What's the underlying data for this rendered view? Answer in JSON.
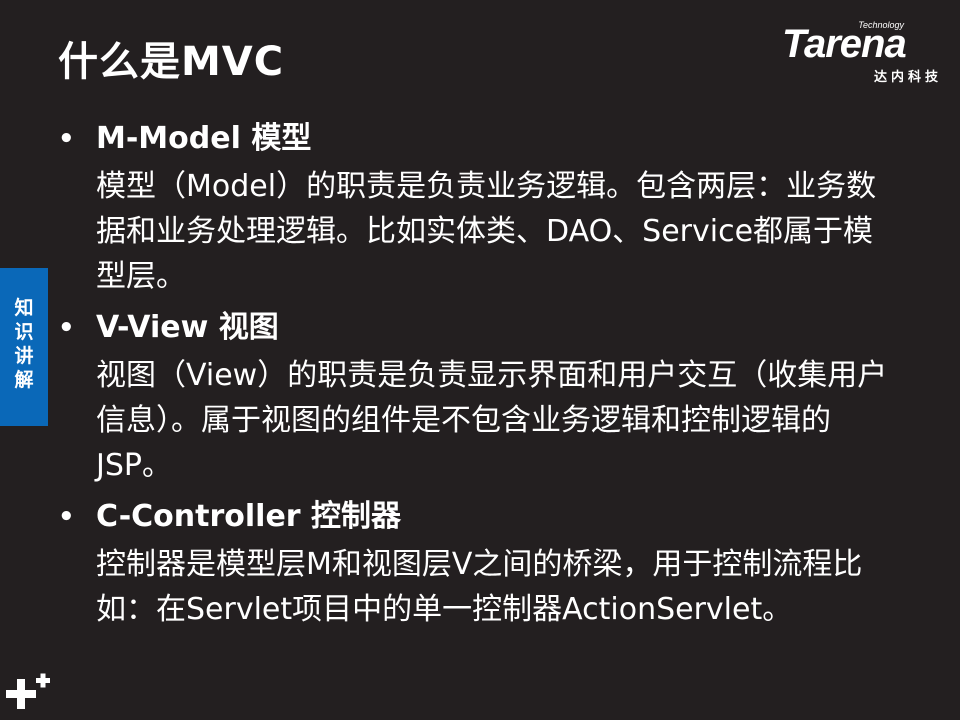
{
  "title": "什么是MVC",
  "logo": {
    "tech": "Technology",
    "main": "Tarena",
    "sub": "达内科技"
  },
  "side_tab": "知识讲解",
  "sections": [
    {
      "heading": "M-Model 模型",
      "body": "模型（Model）的职责是负责业务逻辑。包含两层：业务数据和业务处理逻辑。比如实体类、DAO、Service都属于模型层。"
    },
    {
      "heading": "V-View 视图",
      "body": "视图（View）的职责是负责显示界面和用户交互（收集用户信息）。属于视图的组件是不包含业务逻辑和控制逻辑的JSP。"
    },
    {
      "heading": "C-Controller 控制器",
      "body": "控制器是模型层M和视图层V之间的桥梁，用于控制流程比如：在Servlet项目中的单一控制器ActionServlet。"
    }
  ],
  "bullet": "•",
  "colors": {
    "background": "#231f20",
    "text": "#ffffff",
    "side_tab": "#0a68b8"
  }
}
